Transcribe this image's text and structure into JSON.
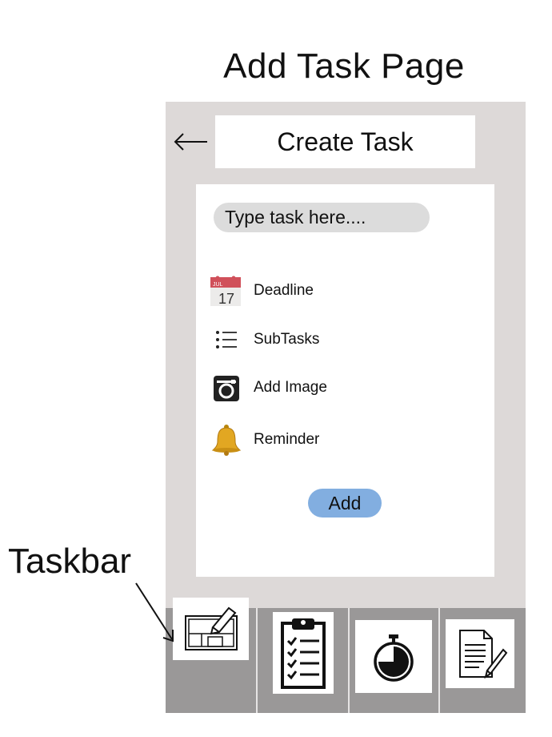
{
  "page_title": "Add Task Page",
  "header": {
    "title": "Create Task",
    "back_icon": "left-arrow-icon"
  },
  "task_input": {
    "placeholder": "Type task here...."
  },
  "options": [
    {
      "label": "Deadline",
      "icon": "calendar-icon",
      "calendar_month": "JUL",
      "calendar_day": "17"
    },
    {
      "label": "SubTasks",
      "icon": "list-icon"
    },
    {
      "label": "Add Image",
      "icon": "camera-icon"
    },
    {
      "label": "Reminder",
      "icon": "bell-icon"
    }
  ],
  "add_button": {
    "label": "Add",
    "color": "#82aee0"
  },
  "taskbar": {
    "annotation": "Taskbar",
    "items": [
      {
        "icon": "edit-board-icon"
      },
      {
        "icon": "clipboard-checklist-icon"
      },
      {
        "icon": "timer-icon"
      },
      {
        "icon": "document-edit-icon"
      }
    ]
  },
  "colors": {
    "phone_bg": "#ddd9d8",
    "taskbar_bg": "#9a9898",
    "input_bg": "#dcdcdc"
  }
}
